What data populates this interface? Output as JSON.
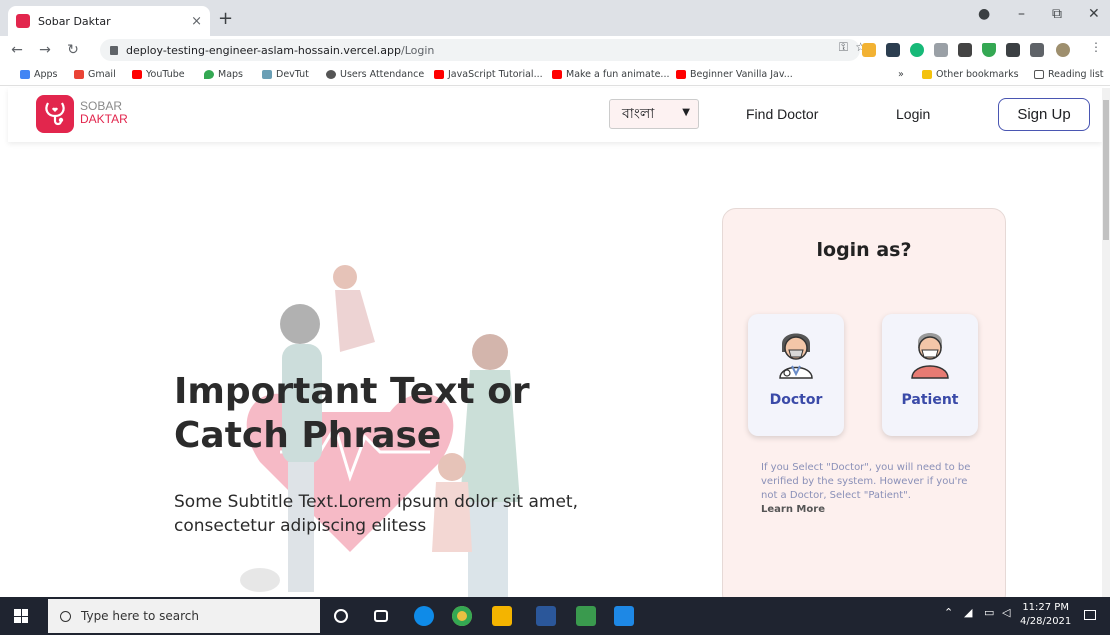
{
  "browser": {
    "tab_title": "Sobar Daktar",
    "tab_close": "×",
    "new_tab": "+",
    "url_host": "deploy-testing-engineer-aslam-hossain.vercel.app",
    "url_path": "/Login",
    "window_minimize": "–",
    "window_restore": "⧉",
    "window_close": "✕"
  },
  "bookmarks": {
    "items": [
      "Apps",
      "Gmail",
      "YouTube",
      "Maps",
      "DevTut",
      "Users Attendance",
      "JavaScript Tutorial...",
      "Make a fun animate...",
      "Beginner Vanilla Jav..."
    ],
    "overflow": "»",
    "other": "Other bookmarks",
    "reading": "Reading list"
  },
  "site": {
    "logo_line1": "SOBAR",
    "logo_line2": "DAKTAR",
    "language": "বাংলা",
    "nav_find_doctor": "Find Doctor",
    "nav_login": "Login",
    "nav_signup": "Sign Up"
  },
  "hero": {
    "title_line1": "Important Text or",
    "title_line2": "Catch Phrase",
    "subtitle": "Some Subtitle Text.Lorem ipsum dolor sit amet, consectetur adipiscing elitess"
  },
  "login_card": {
    "heading": "login as?",
    "doctor_label": "Doctor",
    "patient_label": "Patient",
    "note": "If you Select \"Doctor\", you will need to be verified by the system. However if you're not a Doctor, Select \"Patient\".",
    "learn_more": "Learn More"
  },
  "taskbar": {
    "search_placeholder": "Type here to search",
    "time": "11:27 PM",
    "date": "4/28/2021"
  },
  "colors": {
    "brand": "#e2264d",
    "accent": "#3a4aa8",
    "card_bg": "#fdf0ee"
  }
}
